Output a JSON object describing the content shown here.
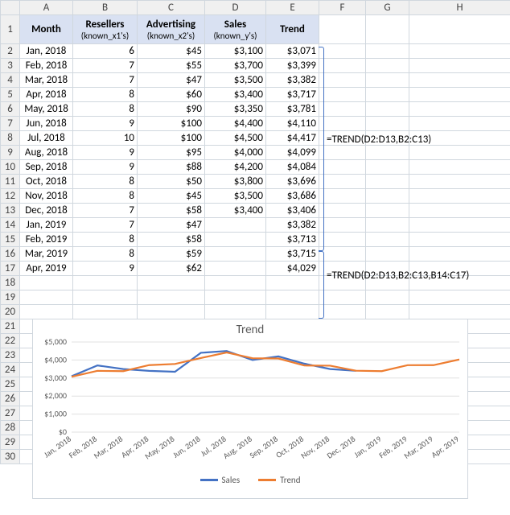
{
  "columns": [
    "",
    "A",
    "B",
    "C",
    "D",
    "E",
    "F",
    "G",
    "H"
  ],
  "row_labels": [
    "1",
    "2",
    "3",
    "4",
    "5",
    "6",
    "7",
    "8",
    "9",
    "10",
    "11",
    "12",
    "13",
    "14",
    "15",
    "16",
    "17",
    "18",
    "19",
    "20",
    "21",
    "22",
    "23",
    "24",
    "25",
    "26",
    "27",
    "28",
    "29",
    "30"
  ],
  "headers": {
    "A": {
      "main": "Month",
      "sub": ""
    },
    "B": {
      "main": "Resellers",
      "sub": "(known_x1's)"
    },
    "C": {
      "main": "Advertising",
      "sub": "(known_x2's)"
    },
    "D": {
      "main": "Sales",
      "sub": "(known_y's)"
    },
    "E": {
      "main": "Trend",
      "sub": ""
    }
  },
  "rows": [
    {
      "month": "Jan, 2018",
      "res": "6",
      "adv": "$45",
      "sales": "$3,100",
      "trend": "$3,071"
    },
    {
      "month": "Feb, 2018",
      "res": "7",
      "adv": "$55",
      "sales": "$3,700",
      "trend": "$3,399"
    },
    {
      "month": "Mar, 2018",
      "res": "7",
      "adv": "$47",
      "sales": "$3,500",
      "trend": "$3,382"
    },
    {
      "month": "Apr, 2018",
      "res": "8",
      "adv": "$60",
      "sales": "$3,400",
      "trend": "$3,717"
    },
    {
      "month": "May, 2018",
      "res": "8",
      "adv": "$90",
      "sales": "$3,350",
      "trend": "$3,781"
    },
    {
      "month": "Jun, 2018",
      "res": "9",
      "adv": "$100",
      "sales": "$4,400",
      "trend": "$4,110"
    },
    {
      "month": "Jul, 2018",
      "res": "10",
      "adv": "$100",
      "sales": "$4,500",
      "trend": "$4,417"
    },
    {
      "month": "Aug, 2018",
      "res": "9",
      "adv": "$95",
      "sales": "$4,000",
      "trend": "$4,099"
    },
    {
      "month": "Sep, 2018",
      "res": "9",
      "adv": "$88",
      "sales": "$4,200",
      "trend": "$4,084"
    },
    {
      "month": "Oct, 2018",
      "res": "8",
      "adv": "$50",
      "sales": "$3,800",
      "trend": "$3,696"
    },
    {
      "month": "Nov, 2018",
      "res": "8",
      "adv": "$45",
      "sales": "$3,500",
      "trend": "$3,686"
    },
    {
      "month": "Dec, 2018",
      "res": "7",
      "adv": "$58",
      "sales": "$3,400",
      "trend": "$3,406"
    },
    {
      "month": "Jan, 2019",
      "res": "7",
      "adv": "$47",
      "sales": "",
      "trend": "$3,382"
    },
    {
      "month": "Feb, 2019",
      "res": "8",
      "adv": "$58",
      "sales": "",
      "trend": "$3,713"
    },
    {
      "month": "Mar, 2019",
      "res": "8",
      "adv": "$59",
      "sales": "",
      "trend": "$3,715"
    },
    {
      "month": "Apr, 2019",
      "res": "9",
      "adv": "$62",
      "sales": "",
      "trend": "$4,029"
    }
  ],
  "formulas": {
    "f1": "=TREND(D2:D13,B2:C13)",
    "f2": "=TREND(D2:D13,B2:C13,B14:C17)"
  },
  "chart_data": {
    "type": "line",
    "title": "Trend",
    "ylabel": "",
    "xlabel": "",
    "ylim": [
      0,
      5000
    ],
    "yticks": [
      "$0",
      "$1,000",
      "$2,000",
      "$3,000",
      "$4,000",
      "$5,000"
    ],
    "categories": [
      "Jan, 2018",
      "Feb, 2018",
      "Mar, 2018",
      "Apr, 2018",
      "May, 2018",
      "Jun, 2018",
      "Jul, 2018",
      "Aug, 2018",
      "Sep, 2018",
      "Oct, 2018",
      "Nov, 2018",
      "Dec, 2018",
      "Jan, 2019",
      "Feb, 2019",
      "Mar, 2019",
      "Apr, 2019"
    ],
    "series": [
      {
        "name": "Sales",
        "color": "#4472c4",
        "values": [
          3100,
          3700,
          3500,
          3400,
          3350,
          4400,
          4500,
          4000,
          4200,
          3800,
          3500,
          3400,
          null,
          null,
          null,
          null
        ]
      },
      {
        "name": "Trend",
        "color": "#ed7d31",
        "values": [
          3071,
          3399,
          3382,
          3717,
          3781,
          4110,
          4417,
          4099,
          4084,
          3696,
          3686,
          3406,
          3382,
          3713,
          3715,
          4029
        ]
      }
    ]
  }
}
